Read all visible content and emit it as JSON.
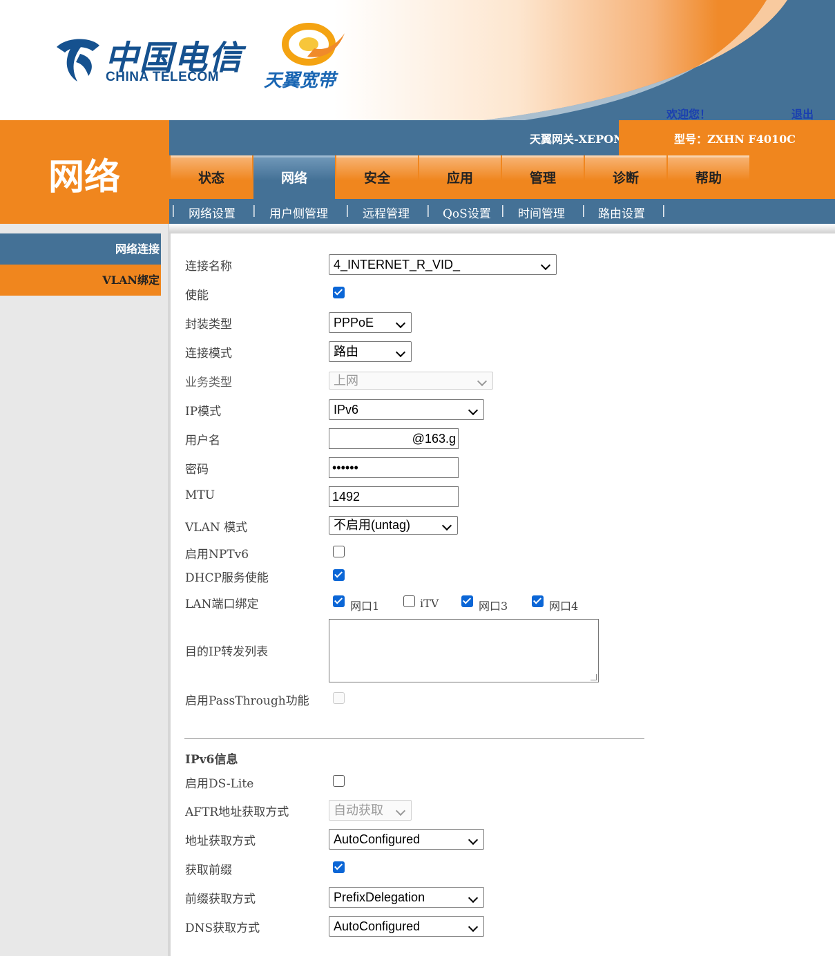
{
  "header": {
    "brand_cn": "中国电信",
    "brand_en": "CHINA TELECOM",
    "tianyi": "天翼宽带",
    "welcome": "欢迎您！",
    "logout": "退出"
  },
  "left_title": "网络",
  "titlebar": {
    "gateway": "天翼网关-XEPON",
    "model": "型号：ZXHN F4010C"
  },
  "tabs": [
    "状态",
    "网络",
    "安全",
    "应用",
    "管理",
    "诊断",
    "帮助"
  ],
  "active_tab": "网络",
  "subnav": [
    "网络设置",
    "用户侧管理",
    "远程管理",
    "QoS设置",
    "时间管理",
    "路由设置"
  ],
  "sidebar": [
    "网络连接",
    "VLAN绑定"
  ],
  "form": {
    "conn_name": {
      "label": "连接名称",
      "value": "4_INTERNET_R_VID_"
    },
    "enable": {
      "label": "使能",
      "checked": true
    },
    "encap": {
      "label": "封装类型",
      "value": "PPPoE"
    },
    "conn_mode": {
      "label": "连接模式",
      "value": "路由"
    },
    "service": {
      "label": "业务类型",
      "value": "上网"
    },
    "ip_mode": {
      "label": "IP模式",
      "value": "IPv6"
    },
    "username": {
      "label": "用户名",
      "value": "@163.g"
    },
    "password": {
      "label": "密码",
      "value": "••••••"
    },
    "mtu": {
      "label": "MTU",
      "value": "1492"
    },
    "vlan_mode": {
      "label": "VLAN 模式",
      "value": "不启用(untag)"
    },
    "nptv6": {
      "label": "启用NPTv6",
      "checked": false
    },
    "dhcp": {
      "label": "DHCP服务使能",
      "checked": true
    },
    "lan_bind": {
      "label": "LAN端口绑定",
      "ports": [
        {
          "name": "网口1",
          "checked": true
        },
        {
          "name": "iTV",
          "checked": false
        },
        {
          "name": "网口3",
          "checked": true
        },
        {
          "name": "网口4",
          "checked": true
        }
      ]
    },
    "dest_ip": {
      "label": "目的IP转发列表"
    },
    "passthrough": {
      "label": "启用PassThrough功能",
      "checked": false
    }
  },
  "ipv6": {
    "title": "IPv6信息",
    "dslite": {
      "label": "启用DS-Lite",
      "checked": false
    },
    "aftr": {
      "label": "AFTR地址获取方式",
      "value": "自动获取"
    },
    "addr": {
      "label": "地址获取方式",
      "value": "AutoConfigured"
    },
    "prefix_get": {
      "label": "获取前缀",
      "checked": true
    },
    "prefix_mode": {
      "label": "前缀获取方式",
      "value": "PrefixDelegation"
    },
    "dns": {
      "label": "DNS获取方式",
      "value": "AutoConfigured"
    }
  },
  "colors": {
    "orange": "#f0861e",
    "steel_blue": "#447196",
    "brand_blue": "#15518f",
    "link_blue": "#1a3fb0",
    "check_blue": "#0b66d6"
  }
}
